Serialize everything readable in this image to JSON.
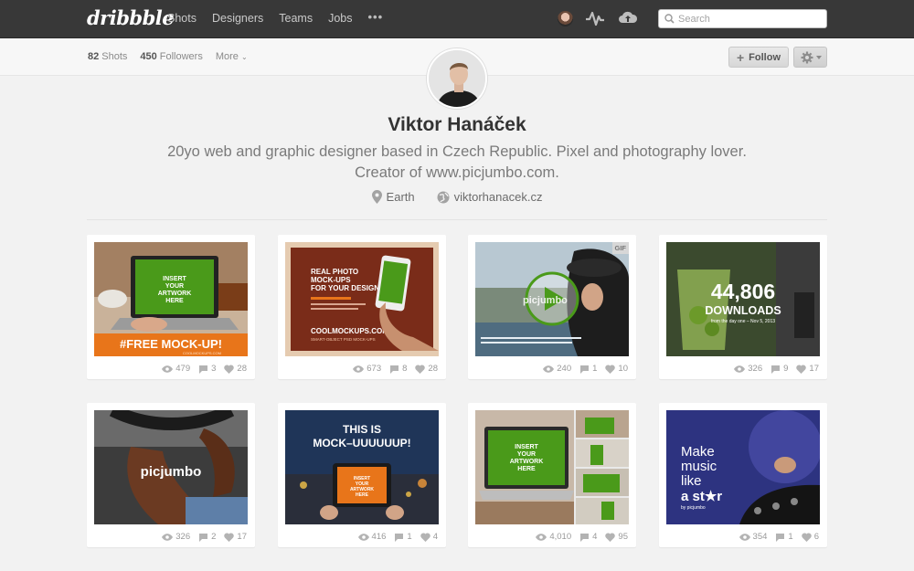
{
  "topbar": {
    "logo": "dribbble",
    "nav": [
      "Shots",
      "Designers",
      "Teams",
      "Jobs",
      "•••"
    ],
    "search_placeholder": "Search"
  },
  "profile": {
    "shots_count": "82",
    "shots_label": "Shots",
    "followers_count": "450",
    "followers_label": "Followers",
    "more_label": "More",
    "follow_label": "Follow",
    "name": "Viktor Hanáček",
    "bio_line1": "20yo web and graphic designer based in Czech Republic. Pixel and photography lover.",
    "bio_line2": "Creator of www.picjumbo.com.",
    "location": "Earth",
    "website": "viktorhanacek.cz"
  },
  "shots": [
    {
      "views": "479",
      "comments": "3",
      "likes": "28",
      "texts": [
        "INSERT",
        "YOUR",
        "ARTWORK",
        "HERE",
        "#FREE MOCK-UP!",
        "COOLMOCKUPS.COM"
      ]
    },
    {
      "views": "673",
      "comments": "8",
      "likes": "28",
      "texts": [
        "REAL PHOTO",
        "MOCK-UPS",
        "FOR YOUR DESIGNS",
        "COOLMOCKUPS.COM",
        "SMART-OBJECT PSD MOCK-UPS"
      ]
    },
    {
      "views": "240",
      "comments": "1",
      "likes": "10",
      "badge": "GIF",
      "texts": [
        "picjumbo"
      ]
    },
    {
      "views": "326",
      "comments": "9",
      "likes": "17",
      "texts": [
        "44,806",
        "DOWNLOADS",
        "from the day one – Nov 5, 2013"
      ]
    },
    {
      "views": "326",
      "comments": "2",
      "likes": "17",
      "texts": [
        "picjumbo"
      ]
    },
    {
      "views": "416",
      "comments": "1",
      "likes": "4",
      "texts": [
        "THIS IS",
        "MOCK–UUUUUUP!",
        "INSERT",
        "YOUR",
        "ARTWORK",
        "HERE"
      ]
    },
    {
      "views": "4,010",
      "comments": "4",
      "likes": "95",
      "texts": [
        "INSERT",
        "YOUR",
        "ARTWORK",
        "HERE"
      ]
    },
    {
      "views": "354",
      "comments": "1",
      "likes": "6",
      "texts": [
        "Make",
        "music",
        "like",
        "a st★r",
        "by picjumbo"
      ]
    }
  ],
  "colors": {
    "topbar": "#383838",
    "mockup_green": "#4a9a1a",
    "mockup_orange": "#e8751a",
    "dribbble_pink": "#ea4c89"
  },
  "icons": [
    "search-icon",
    "activity-icon",
    "upload-cloud-icon",
    "plus-icon",
    "gear-icon",
    "location-pin-icon",
    "globe-icon",
    "eye-icon",
    "comment-icon",
    "heart-icon",
    "play-icon"
  ]
}
